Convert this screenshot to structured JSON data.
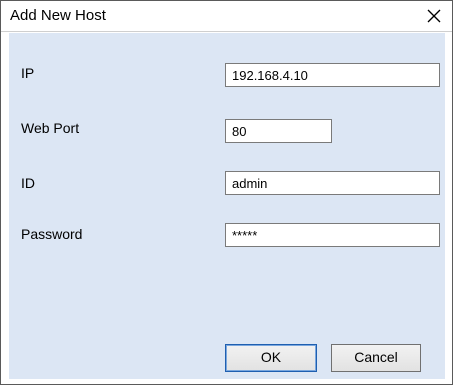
{
  "dialog": {
    "title": "Add New Host"
  },
  "fields": {
    "ip": {
      "label": "IP",
      "value": "192.168.4.10"
    },
    "web_port": {
      "label": "Web Port",
      "value": "80"
    },
    "id": {
      "label": "ID",
      "value": "admin"
    },
    "password": {
      "label": "Password",
      "value": "*****"
    }
  },
  "buttons": {
    "ok": "OK",
    "cancel": "Cancel"
  },
  "icons": {
    "close": "close-icon"
  },
  "colors": {
    "client_background": "#dce6f4",
    "title_background": "#ffffff"
  }
}
